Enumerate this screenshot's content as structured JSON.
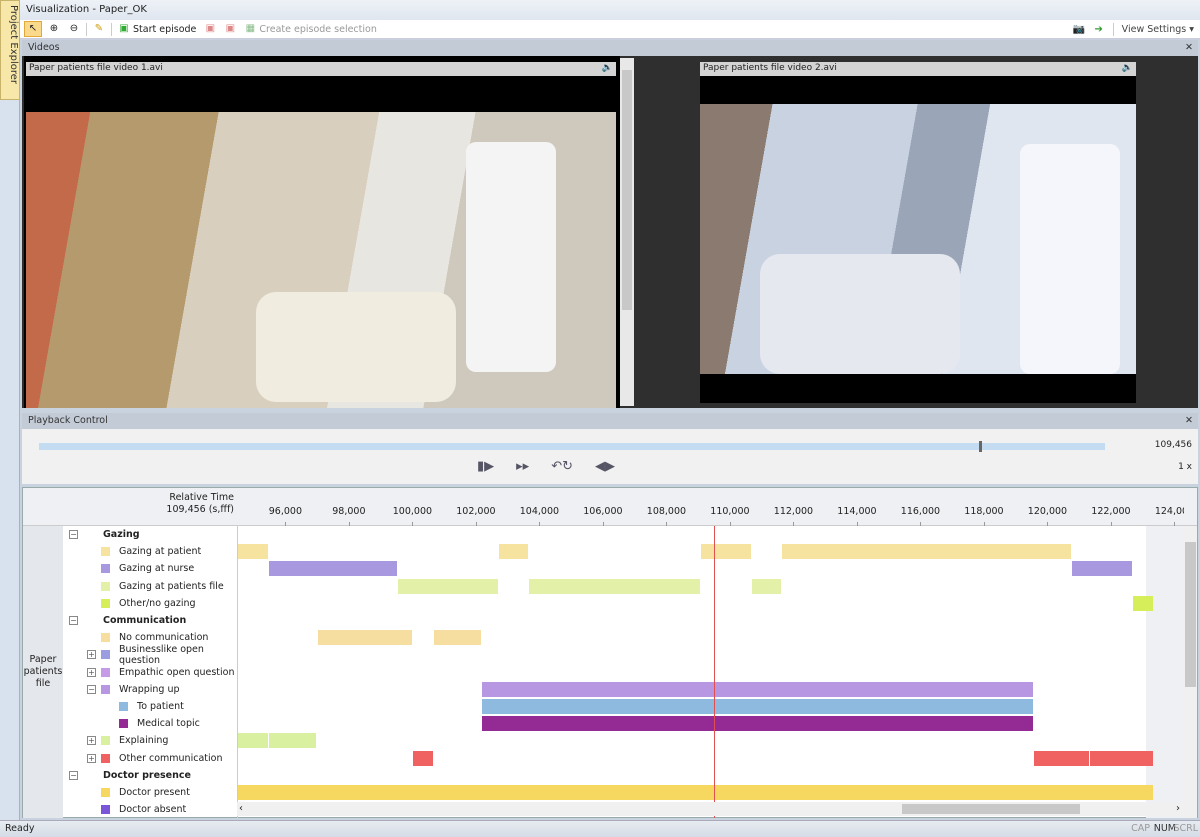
{
  "window": {
    "title": "Visualization - Paper_OK",
    "side_tab": "Project Explorer"
  },
  "toolbar": {
    "start_episode": "Start episode",
    "create_selection": "Create episode selection",
    "view_settings": "View Settings"
  },
  "videos": {
    "panel_title": "Videos",
    "video1": "Paper patients file video 1.avi",
    "video2": "Paper patients file video 2.avi"
  },
  "playback": {
    "panel_title": "Playback Control",
    "position": "109,456",
    "speed": "1 x",
    "progress_fraction": 0.882
  },
  "timeline": {
    "header_label": "Relative Time",
    "header_value": "109,456 (s,fff)",
    "group_label": "Paper patients file",
    "cursor_time": 109456,
    "axis_start": 94476,
    "axis_end": 124300,
    "ticks": [
      "96,000",
      "98,000",
      "100,000",
      "102,000",
      "104,000",
      "106,000",
      "108,000",
      "110,000",
      "112,000",
      "114,000",
      "116,000",
      "118,000",
      "120,000",
      "122,000",
      "124,000"
    ],
    "tick_values": [
      96000,
      98000,
      100000,
      102000,
      104000,
      106000,
      108000,
      110000,
      112000,
      114000,
      116000,
      118000,
      120000,
      122000,
      124000
    ],
    "rows": [
      {
        "label": "Gazing",
        "type": "group",
        "toggle": "minus"
      },
      {
        "label": "Gazing at patient",
        "color": "#f6e3a0",
        "bars": [
          [
            94476,
            95460
          ],
          [
            102700,
            103650
          ],
          [
            109050,
            110670
          ],
          [
            111620,
            120730
          ]
        ]
      },
      {
        "label": "Gazing at nurse",
        "color": "#a898e0",
        "bars": [
          [
            95460,
            99520
          ],
          [
            120730,
            122670
          ]
        ]
      },
      {
        "label": "Gazing at patients file",
        "color": "#e2f0a8",
        "bars": [
          [
            99520,
            102700
          ],
          [
            103650,
            109050
          ],
          [
            110670,
            111620
          ]
        ]
      },
      {
        "label": "Other/no gazing",
        "color": "#d6ee5a",
        "bars": [
          [
            122670,
            123330
          ]
        ]
      },
      {
        "label": "Communication",
        "type": "group",
        "toggle": "minus"
      },
      {
        "label": "No communication",
        "color": "#f6dea0",
        "bars": [
          [
            96980,
            100000
          ],
          [
            100640,
            102160
          ]
        ]
      },
      {
        "label": "Businesslike open question",
        "color": "#9a9ee0",
        "toggle": "plus",
        "bars": []
      },
      {
        "label": "Empathic open question",
        "color": "#c59ae6",
        "toggle": "plus",
        "bars": []
      },
      {
        "label": "Wrapping up",
        "color": "#b897e2",
        "toggle": "minus",
        "bars": [
          [
            102160,
            119555
          ]
        ]
      },
      {
        "label": "To patient",
        "color": "#8fbadf",
        "indent": true,
        "bars": [
          [
            102160,
            119555
          ]
        ]
      },
      {
        "label": "Medical topic",
        "color": "#942a94",
        "indent": true,
        "bars": [
          [
            102160,
            119555
          ]
        ]
      },
      {
        "label": "Explaining",
        "color": "#d8f0a0",
        "toggle": "plus",
        "bars": [
          [
            94476,
            95460
          ],
          [
            95460,
            96980
          ]
        ]
      },
      {
        "label": "Other communication",
        "color": "#f06262",
        "toggle": "plus",
        "bars": [
          [
            100000,
            100640
          ],
          [
            119555,
            121310
          ],
          [
            121310,
            123330
          ]
        ]
      },
      {
        "label": "Doctor presence",
        "type": "group",
        "toggle": "minus"
      },
      {
        "label": "Doctor present",
        "color": "#f6d860",
        "bars": [
          [
            94476,
            123330
          ]
        ]
      },
      {
        "label": "Doctor absent",
        "color": "#7a55d8",
        "bars": []
      }
    ]
  },
  "status": {
    "text": "Ready",
    "cap": "CAP",
    "num": "NUM",
    "scrl": "SCRL"
  }
}
